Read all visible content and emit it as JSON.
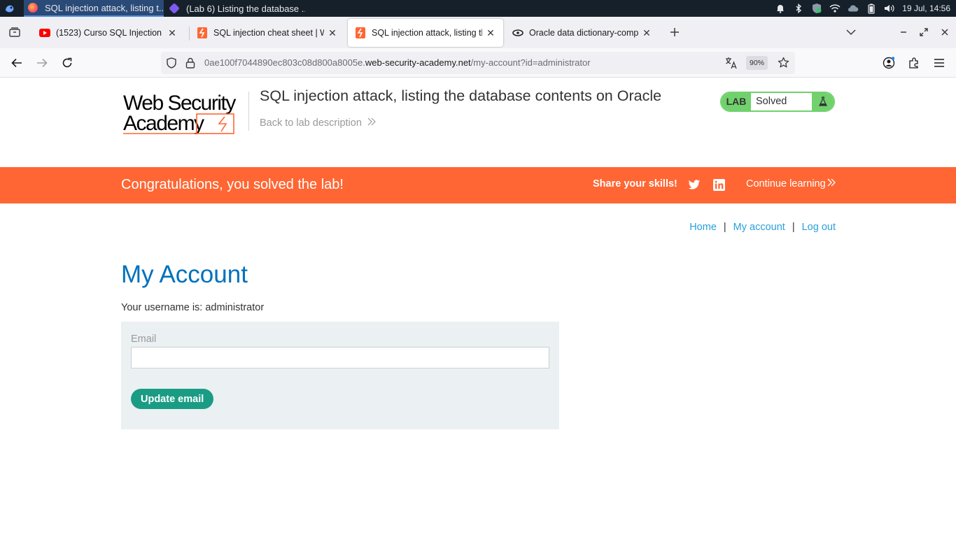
{
  "taskbar": {
    "tasks": [
      {
        "label": "SQL injection attack, listing t..."
      },
      {
        "label": "(Lab 6) Listing the database ..."
      }
    ],
    "clock": "19 Jul, 14:56"
  },
  "browser": {
    "tabs": [
      {
        "title": "(1523) Curso SQL Injection (SC"
      },
      {
        "title": "SQL injection cheat sheet | W"
      },
      {
        "title": "SQL injection attack, listing th"
      },
      {
        "title": "Oracle data dictionary-compa"
      }
    ],
    "url": {
      "prefix": "0ae100f7044890ec803c08d800a8005e.",
      "host": "web-security-academy.net",
      "path": "/my-account?id=administrator"
    },
    "zoom": "90%"
  },
  "page": {
    "logo_line1": "Web Security",
    "logo_line2": "Academy",
    "lab_title": "SQL injection attack, listing the database contents on Oracle",
    "back_link": "Back to lab description",
    "lab_badge": {
      "tag": "LAB",
      "state": "Solved"
    },
    "banner": {
      "message": "Congratulations, you solved the lab!",
      "share": "Share your skills!",
      "continue": "Continue learning"
    },
    "nav": {
      "home": "Home",
      "sep": "|",
      "account": "My account",
      "logout": "Log out"
    },
    "heading": "My Account",
    "username_line": "Your username is: administrator",
    "form": {
      "email_label": "Email",
      "email_value": "",
      "button": "Update email"
    }
  },
  "colors": {
    "accent_orange": "#ff6633",
    "heading_blue": "#0071bc",
    "link_blue": "#29a0d8",
    "solved_green": "#70d16d",
    "button_teal": "#1a9c84"
  }
}
